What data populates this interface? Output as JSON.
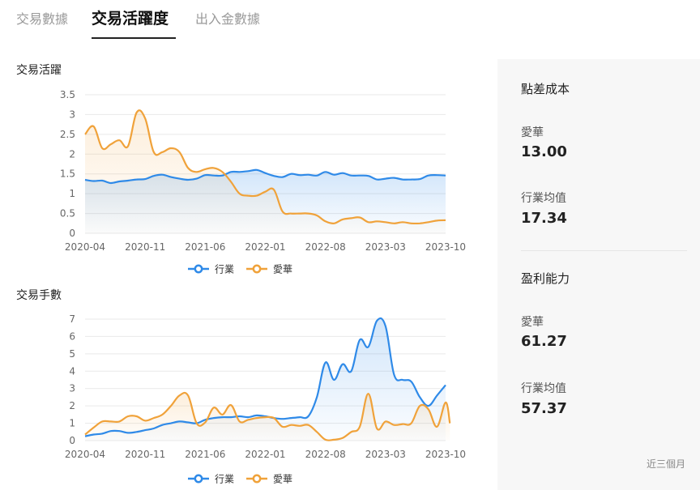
{
  "tabs": [
    {
      "label": "交易數據",
      "active": false
    },
    {
      "label": "交易活躍度",
      "active": true
    },
    {
      "label": "出入金數據",
      "active": false
    }
  ],
  "colors": {
    "industry": "#2f8ae8",
    "company": "#f0a23a",
    "grid": "#e9e9e9",
    "axis_text": "#666666"
  },
  "panel": {
    "spread_title": "點差成本",
    "spread_company_label": "愛華",
    "spread_company_value": "13.00",
    "spread_industry_label": "行業均值",
    "spread_industry_value": "17.34",
    "profit_title": "盈利能力",
    "profit_company_label": "愛華",
    "profit_company_value": "61.27",
    "profit_industry_label": "行業均值",
    "profit_industry_value": "57.37",
    "footnote": "近三個月"
  },
  "chart_data": [
    {
      "type": "area",
      "title": "交易活躍",
      "xlabel": "",
      "ylabel": "",
      "ylim": [
        0,
        3.5
      ],
      "yticks": [
        "0",
        "0.5",
        "1",
        "1.5",
        "2",
        "2.5",
        "3",
        "3.5"
      ],
      "xlim": [
        0,
        42
      ],
      "xticks": [
        {
          "x": 0,
          "label": "2020-04"
        },
        {
          "x": 7,
          "label": "2020-11"
        },
        {
          "x": 14,
          "label": "2021-06"
        },
        {
          "x": 21,
          "label": "2022-01"
        },
        {
          "x": 28,
          "label": "2022-08"
        },
        {
          "x": 35,
          "label": "2023-03"
        },
        {
          "x": 42,
          "label": "2023-10"
        }
      ],
      "legend": "bottom",
      "grid": true,
      "series": [
        {
          "name": "行業",
          "color": "#2f8ae8",
          "points": [
            [
              0,
              1.35
            ],
            [
              1,
              1.32
            ],
            [
              2,
              1.33
            ],
            [
              3,
              1.27
            ],
            [
              4,
              1.31
            ],
            [
              5,
              1.33
            ],
            [
              6,
              1.36
            ],
            [
              7,
              1.37
            ],
            [
              8,
              1.45
            ],
            [
              9,
              1.48
            ],
            [
              10,
              1.42
            ],
            [
              11,
              1.38
            ],
            [
              12,
              1.35
            ],
            [
              13,
              1.38
            ],
            [
              14,
              1.47
            ],
            [
              15,
              1.46
            ],
            [
              16,
              1.46
            ],
            [
              17,
              1.55
            ],
            [
              18,
              1.55
            ],
            [
              19,
              1.57
            ],
            [
              20,
              1.6
            ],
            [
              21,
              1.52
            ],
            [
              22,
              1.45
            ],
            [
              23,
              1.42
            ],
            [
              24,
              1.5
            ],
            [
              25,
              1.47
            ],
            [
              26,
              1.48
            ],
            [
              27,
              1.46
            ],
            [
              28,
              1.55
            ],
            [
              29,
              1.48
            ],
            [
              30,
              1.52
            ],
            [
              31,
              1.46
            ],
            [
              32,
              1.46
            ],
            [
              33,
              1.45
            ],
            [
              34,
              1.36
            ],
            [
              35,
              1.38
            ],
            [
              36,
              1.4
            ],
            [
              37,
              1.36
            ],
            [
              38,
              1.36
            ],
            [
              39,
              1.37
            ],
            [
              40,
              1.46
            ],
            [
              41,
              1.47
            ],
            [
              42,
              1.46
            ]
          ]
        },
        {
          "name": "愛華",
          "color": "#f0a23a",
          "points": [
            [
              0,
              2.5
            ],
            [
              1,
              2.7
            ],
            [
              2,
              2.15
            ],
            [
              3,
              2.25
            ],
            [
              4,
              2.35
            ],
            [
              5,
              2.2
            ],
            [
              6,
              3.05
            ],
            [
              7,
              2.9
            ],
            [
              8,
              2.05
            ],
            [
              9,
              2.05
            ],
            [
              10,
              2.15
            ],
            [
              11,
              2.05
            ],
            [
              12,
              1.65
            ],
            [
              13,
              1.55
            ],
            [
              14,
              1.62
            ],
            [
              15,
              1.65
            ],
            [
              16,
              1.55
            ],
            [
              17,
              1.3
            ],
            [
              18,
              1.0
            ],
            [
              19,
              0.95
            ],
            [
              20,
              0.95
            ],
            [
              21,
              1.05
            ],
            [
              22,
              1.1
            ],
            [
              23,
              0.55
            ],
            [
              24,
              0.5
            ],
            [
              25,
              0.5
            ],
            [
              26,
              0.5
            ],
            [
              27,
              0.45
            ],
            [
              28,
              0.3
            ],
            [
              29,
              0.25
            ],
            [
              30,
              0.35
            ],
            [
              31,
              0.38
            ],
            [
              32,
              0.4
            ],
            [
              33,
              0.28
            ],
            [
              34,
              0.3
            ],
            [
              35,
              0.28
            ],
            [
              36,
              0.25
            ],
            [
              37,
              0.28
            ],
            [
              38,
              0.25
            ],
            [
              39,
              0.25
            ],
            [
              40,
              0.28
            ],
            [
              41,
              0.32
            ],
            [
              42,
              0.33
            ]
          ]
        }
      ]
    },
    {
      "type": "area",
      "title": "交易手數",
      "xlabel": "",
      "ylabel": "",
      "ylim": [
        0,
        7
      ],
      "yticks": [
        "0",
        "1",
        "2",
        "3",
        "4",
        "5",
        "6",
        "7"
      ],
      "xlim": [
        0,
        42
      ],
      "xticks": [
        {
          "x": 0,
          "label": "2020-04"
        },
        {
          "x": 7,
          "label": "2020-11"
        },
        {
          "x": 14,
          "label": "2021-06"
        },
        {
          "x": 21,
          "label": "2022-01"
        },
        {
          "x": 28,
          "label": "2022-08"
        },
        {
          "x": 35,
          "label": "2023-03"
        },
        {
          "x": 42,
          "label": "2023-10"
        }
      ],
      "legend": "bottom",
      "grid": true,
      "series": [
        {
          "name": "行業",
          "color": "#2f8ae8",
          "points": [
            [
              0,
              0.25
            ],
            [
              1,
              0.35
            ],
            [
              2,
              0.4
            ],
            [
              3,
              0.55
            ],
            [
              4,
              0.55
            ],
            [
              5,
              0.45
            ],
            [
              6,
              0.5
            ],
            [
              7,
              0.6
            ],
            [
              8,
              0.7
            ],
            [
              9,
              0.9
            ],
            [
              10,
              1.0
            ],
            [
              11,
              1.1
            ],
            [
              12,
              1.05
            ],
            [
              13,
              1.0
            ],
            [
              14,
              1.2
            ],
            [
              15,
              1.3
            ],
            [
              16,
              1.35
            ],
            [
              17,
              1.35
            ],
            [
              18,
              1.4
            ],
            [
              19,
              1.35
            ],
            [
              20,
              1.45
            ],
            [
              21,
              1.4
            ],
            [
              22,
              1.3
            ],
            [
              23,
              1.25
            ],
            [
              24,
              1.3
            ],
            [
              25,
              1.35
            ],
            [
              26,
              1.4
            ],
            [
              27,
              2.5
            ],
            [
              28,
              4.5
            ],
            [
              29,
              3.5
            ],
            [
              30,
              4.4
            ],
            [
              31,
              4.0
            ],
            [
              32,
              5.8
            ],
            [
              33,
              5.4
            ],
            [
              34,
              6.9
            ],
            [
              35,
              6.6
            ],
            [
              36,
              3.8
            ],
            [
              37,
              3.5
            ],
            [
              38,
              3.4
            ],
            [
              39,
              2.5
            ],
            [
              40,
              2.0
            ],
            [
              41,
              2.6
            ],
            [
              42,
              3.2
            ]
          ]
        },
        {
          "name": "愛華",
          "color": "#f0a23a",
          "points": [
            [
              0,
              0.35
            ],
            [
              1,
              0.75
            ],
            [
              2,
              1.1
            ],
            [
              3,
              1.1
            ],
            [
              4,
              1.1
            ],
            [
              5,
              1.4
            ],
            [
              6,
              1.4
            ],
            [
              7,
              1.15
            ],
            [
              8,
              1.3
            ],
            [
              9,
              1.5
            ],
            [
              10,
              2.0
            ],
            [
              11,
              2.6
            ],
            [
              12,
              2.6
            ],
            [
              13,
              1.0
            ],
            [
              14,
              1.05
            ],
            [
              15,
              1.9
            ],
            [
              16,
              1.5
            ],
            [
              17,
              2.05
            ],
            [
              18,
              1.1
            ],
            [
              19,
              1.2
            ],
            [
              20,
              1.3
            ],
            [
              21,
              1.35
            ],
            [
              22,
              1.3
            ],
            [
              23,
              0.8
            ],
            [
              24,
              0.9
            ],
            [
              25,
              0.85
            ],
            [
              26,
              0.9
            ],
            [
              27,
              0.5
            ],
            [
              28,
              0.05
            ],
            [
              29,
              0.05
            ],
            [
              30,
              0.15
            ],
            [
              31,
              0.5
            ],
            [
              32,
              0.8
            ],
            [
              33,
              2.7
            ],
            [
              34,
              0.7
            ],
            [
              35,
              1.1
            ],
            [
              36,
              0.9
            ],
            [
              37,
              0.95
            ],
            [
              38,
              1.0
            ],
            [
              39,
              2.0
            ],
            [
              40,
              1.8
            ],
            [
              41,
              0.8
            ],
            [
              42,
              2.2
            ],
            [
              42.5,
              1.0
            ]
          ]
        }
      ]
    }
  ]
}
